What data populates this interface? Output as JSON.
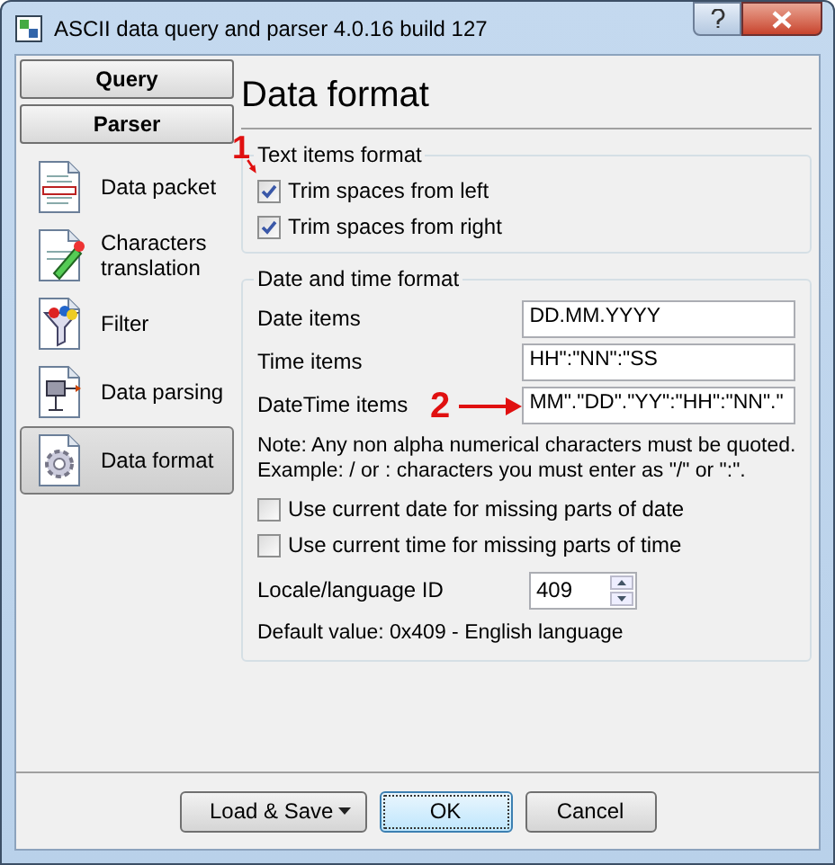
{
  "window": {
    "title": "ASCII data query and parser 4.0.16 build 127"
  },
  "sidebar": {
    "headers": [
      {
        "label": "Query"
      },
      {
        "label": "Parser"
      }
    ],
    "items": [
      {
        "label": "Data packet",
        "kind": "packet",
        "selected": false
      },
      {
        "label": "Characters translation",
        "kind": "translation",
        "selected": false
      },
      {
        "label": "Filter",
        "kind": "filter",
        "selected": false
      },
      {
        "label": "Data parsing",
        "kind": "parsing",
        "selected": false
      },
      {
        "label": "Data format",
        "kind": "format",
        "selected": true
      }
    ]
  },
  "page": {
    "title": "Data format",
    "groups": [
      {
        "title": "Text items format",
        "rows": [
          {
            "kind": "checkbox",
            "label": "Trim spaces from left",
            "checked": true
          },
          {
            "kind": "checkbox",
            "label": "Trim spaces from right",
            "checked": true
          }
        ]
      },
      {
        "title": "Date and time format",
        "rows": [
          {
            "kind": "field",
            "label": "Date items",
            "value": "DD.MM.YYYY"
          },
          {
            "kind": "field",
            "label": "Time items",
            "value": "HH\":\"NN\":\"SS"
          },
          {
            "kind": "field",
            "label": "DateTime items",
            "value": "MM\".\"DD\".\"YY\":\"HH\":\"NN\".\""
          },
          {
            "kind": "note",
            "lines": [
              "Note: Any non alpha numerical characters must be quoted.",
              "Example: / or : characters you must enter as \"/\" or \":\"."
            ]
          },
          {
            "kind": "checkbox",
            "label": "Use current date for missing parts of date",
            "checked": false
          },
          {
            "kind": "checkbox",
            "label": "Use current time for missing parts of time",
            "checked": false
          },
          {
            "kind": "spinner",
            "label": "Locale/language ID",
            "value": "409"
          },
          {
            "kind": "note",
            "lines": [
              "Default value: 0x409 - English language"
            ]
          }
        ]
      }
    ]
  },
  "buttons": [
    {
      "label": "Load & Save",
      "kind": "dropdown"
    },
    {
      "label": "OK",
      "kind": "default"
    },
    {
      "label": "Cancel",
      "kind": "plain"
    }
  ],
  "annotations": [
    {
      "label": "1"
    },
    {
      "label": "2"
    }
  ]
}
